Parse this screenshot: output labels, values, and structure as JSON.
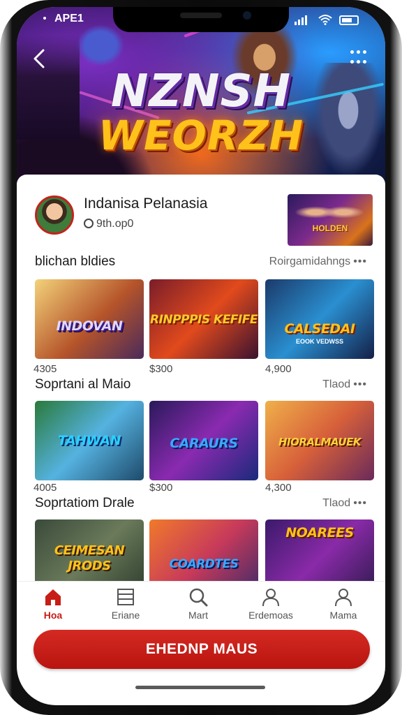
{
  "status_bar": {
    "time": "APE1"
  },
  "hero": {
    "title_line1": "NZNSH",
    "title_line2": "WEORZH"
  },
  "profile": {
    "name": "Indanisa Pelanasia",
    "subtitle": "9th.op0",
    "promo_title": "HOLDEN"
  },
  "sections": [
    {
      "title": "blichan bldies",
      "link": "Roirgamidahngs",
      "cards": [
        {
          "title": "INDOVAN",
          "subtitle": "",
          "price": "4305"
        },
        {
          "title": "RINPPPIS KEFIFE",
          "subtitle": "",
          "price": "$300"
        },
        {
          "title": "CALSEDAI",
          "subtitle": "EOOK VEDWSS",
          "price": "4,900"
        }
      ]
    },
    {
      "title": "Soprtani al Maio",
      "link": "Tlaod",
      "cards": [
        {
          "title": "TAHWAN",
          "subtitle": "",
          "price": "4005"
        },
        {
          "title": "CARAURS",
          "subtitle": "",
          "price": "$300"
        },
        {
          "title": "HIORALMAUEK",
          "subtitle": "",
          "price": "4,300"
        }
      ]
    },
    {
      "title": "Soprtatiom Drale",
      "link": "Tlaod",
      "cards": [
        {
          "title": "CEIMESAN JRODS",
          "subtitle": ""
        },
        {
          "title": "COARDTES",
          "subtitle": ""
        },
        {
          "title": "NOAREES",
          "subtitle": ""
        }
      ]
    }
  ],
  "nav": [
    {
      "label": "Hoa",
      "icon": "home-icon",
      "active": true
    },
    {
      "label": "Eriane",
      "icon": "list-icon",
      "active": false
    },
    {
      "label": "Mart",
      "icon": "search-icon",
      "active": false
    },
    {
      "label": "Erdemoas",
      "icon": "user-icon",
      "active": false
    },
    {
      "label": "Mama",
      "icon": "profile-icon",
      "active": false
    }
  ],
  "cta": {
    "label": "EHEDNP MAUS"
  },
  "colors": {
    "accent": "#c81c16",
    "nav_active": "#c81c16"
  }
}
